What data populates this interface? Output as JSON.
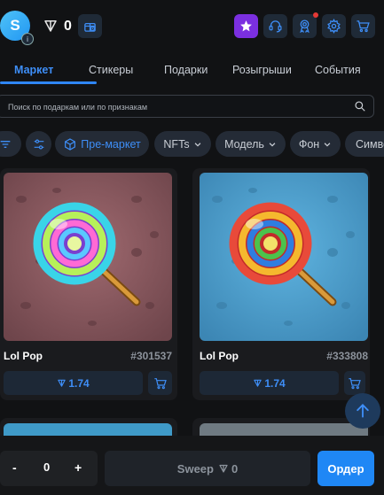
{
  "header": {
    "avatar_letter": "S",
    "balance": "0"
  },
  "tabs": [
    {
      "label": "Маркет",
      "active": true
    },
    {
      "label": "Стикеры"
    },
    {
      "label": "Подарки"
    },
    {
      "label": "Розыгрыши"
    },
    {
      "label": "События"
    }
  ],
  "search": {
    "placeholder": "Поиск по подаркам или по признакам",
    "value": ""
  },
  "filters": {
    "premarket": "Пре-маркет",
    "nfts": "NFTs",
    "model": "Модель",
    "background": "Фон",
    "symbol": "Симво"
  },
  "items": [
    {
      "name": "Lol Pop",
      "number": "#301537",
      "price": "1.74"
    },
    {
      "name": "Lol Pop",
      "number": "#333808",
      "price": "1.74"
    }
  ],
  "bottom": {
    "minus": "-",
    "quantity": "0",
    "plus": "+",
    "sweep_label": "Sweep",
    "sweep_amount": "0",
    "order_label": "Ордер"
  },
  "colors": {
    "accent": "#2f86f6",
    "premium": "#7b2fe0",
    "card1_bg": "#8a5a60",
    "card2_bg": "#4a9ccc"
  },
  "icons": [
    "ton-icon",
    "gift-icon",
    "star-icon",
    "headset-icon",
    "award-icon",
    "gear-icon",
    "cart-icon",
    "search-icon",
    "filter-icon",
    "sliders-icon",
    "cube-icon",
    "chevron-down-icon",
    "arrow-up-icon"
  ]
}
